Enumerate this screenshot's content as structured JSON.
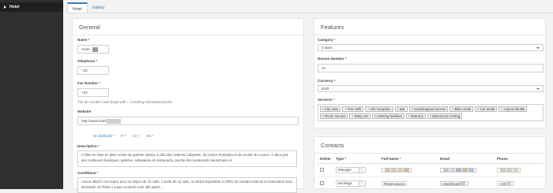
{
  "sidebar": {
    "active_label": "Hotel"
  },
  "tabs": [
    {
      "label": "Hotel"
    },
    {
      "label": "Gallery"
    }
  ],
  "general": {
    "title": "General",
    "name_label": "Name",
    "name_value": "Hotel",
    "telephone_label": "Telephone",
    "telephone_value": "+33",
    "fax_label": "Fax Number",
    "fax_value": "+33",
    "fax_hint": "The fax number must begin with +, including international prefix",
    "website_label": "Website",
    "website_value": "http://www.hotel",
    "languages": [
      "En (Default) *",
      "Fr *",
      "Cn *",
      "De *"
    ],
    "description_label": "Description",
    "description_text": "L'hôtel se situe en plein centre du quartier Opéra, à côté des Galeries Lafayette, du Centre Pompidou et du musée du Louvre. À deux pas des meilleures boutiques, galeries, antiquaires et restaurants, proche des boulevards Haussmann et",
    "conditions_label": "Conditions",
    "conditions_text": "Aucun dépôt n est requis pour un séjour de 10 nuits. À partir de 11 nuits, un dépôt équivalent à 100% du montant total de la réservation sera demandé. Si l'hôtel n a pas contacté sous 48h après ..."
  },
  "features": {
    "title": "Features",
    "category_label": "Category",
    "category_value": "4 stars",
    "rooms_label": "Rooms Number",
    "rooms_value": "44",
    "currency_label": "Currency",
    "currency_value": "EUR",
    "services_label": "Services",
    "services": [
      "City view",
      "Free Wifi",
      "24h reception",
      "Bar",
      "Handicapped access",
      "Bike rental",
      "Car rental",
      "Airport shuttle",
      "Room service",
      "Baby cot",
      "meeting facilities",
      "Balcony",
      "Motorcycle renting"
    ]
  },
  "contacts": {
    "title": "Contacts",
    "columns": [
      "Delete",
      "Type",
      "Full Name",
      "Email",
      "Phone"
    ],
    "rows": [
      {
        "type": "Manager",
        "name": "",
        "email": "",
        "phone": ""
      },
      {
        "type": "Bookings",
        "name": "Réservations",
        "email": "info@hotel",
        "phone": "+33"
      }
    ]
  },
  "colors": {
    "accent": "#3a7bbf",
    "sidebar": "#2f2f2f",
    "required": "#c0392b"
  }
}
